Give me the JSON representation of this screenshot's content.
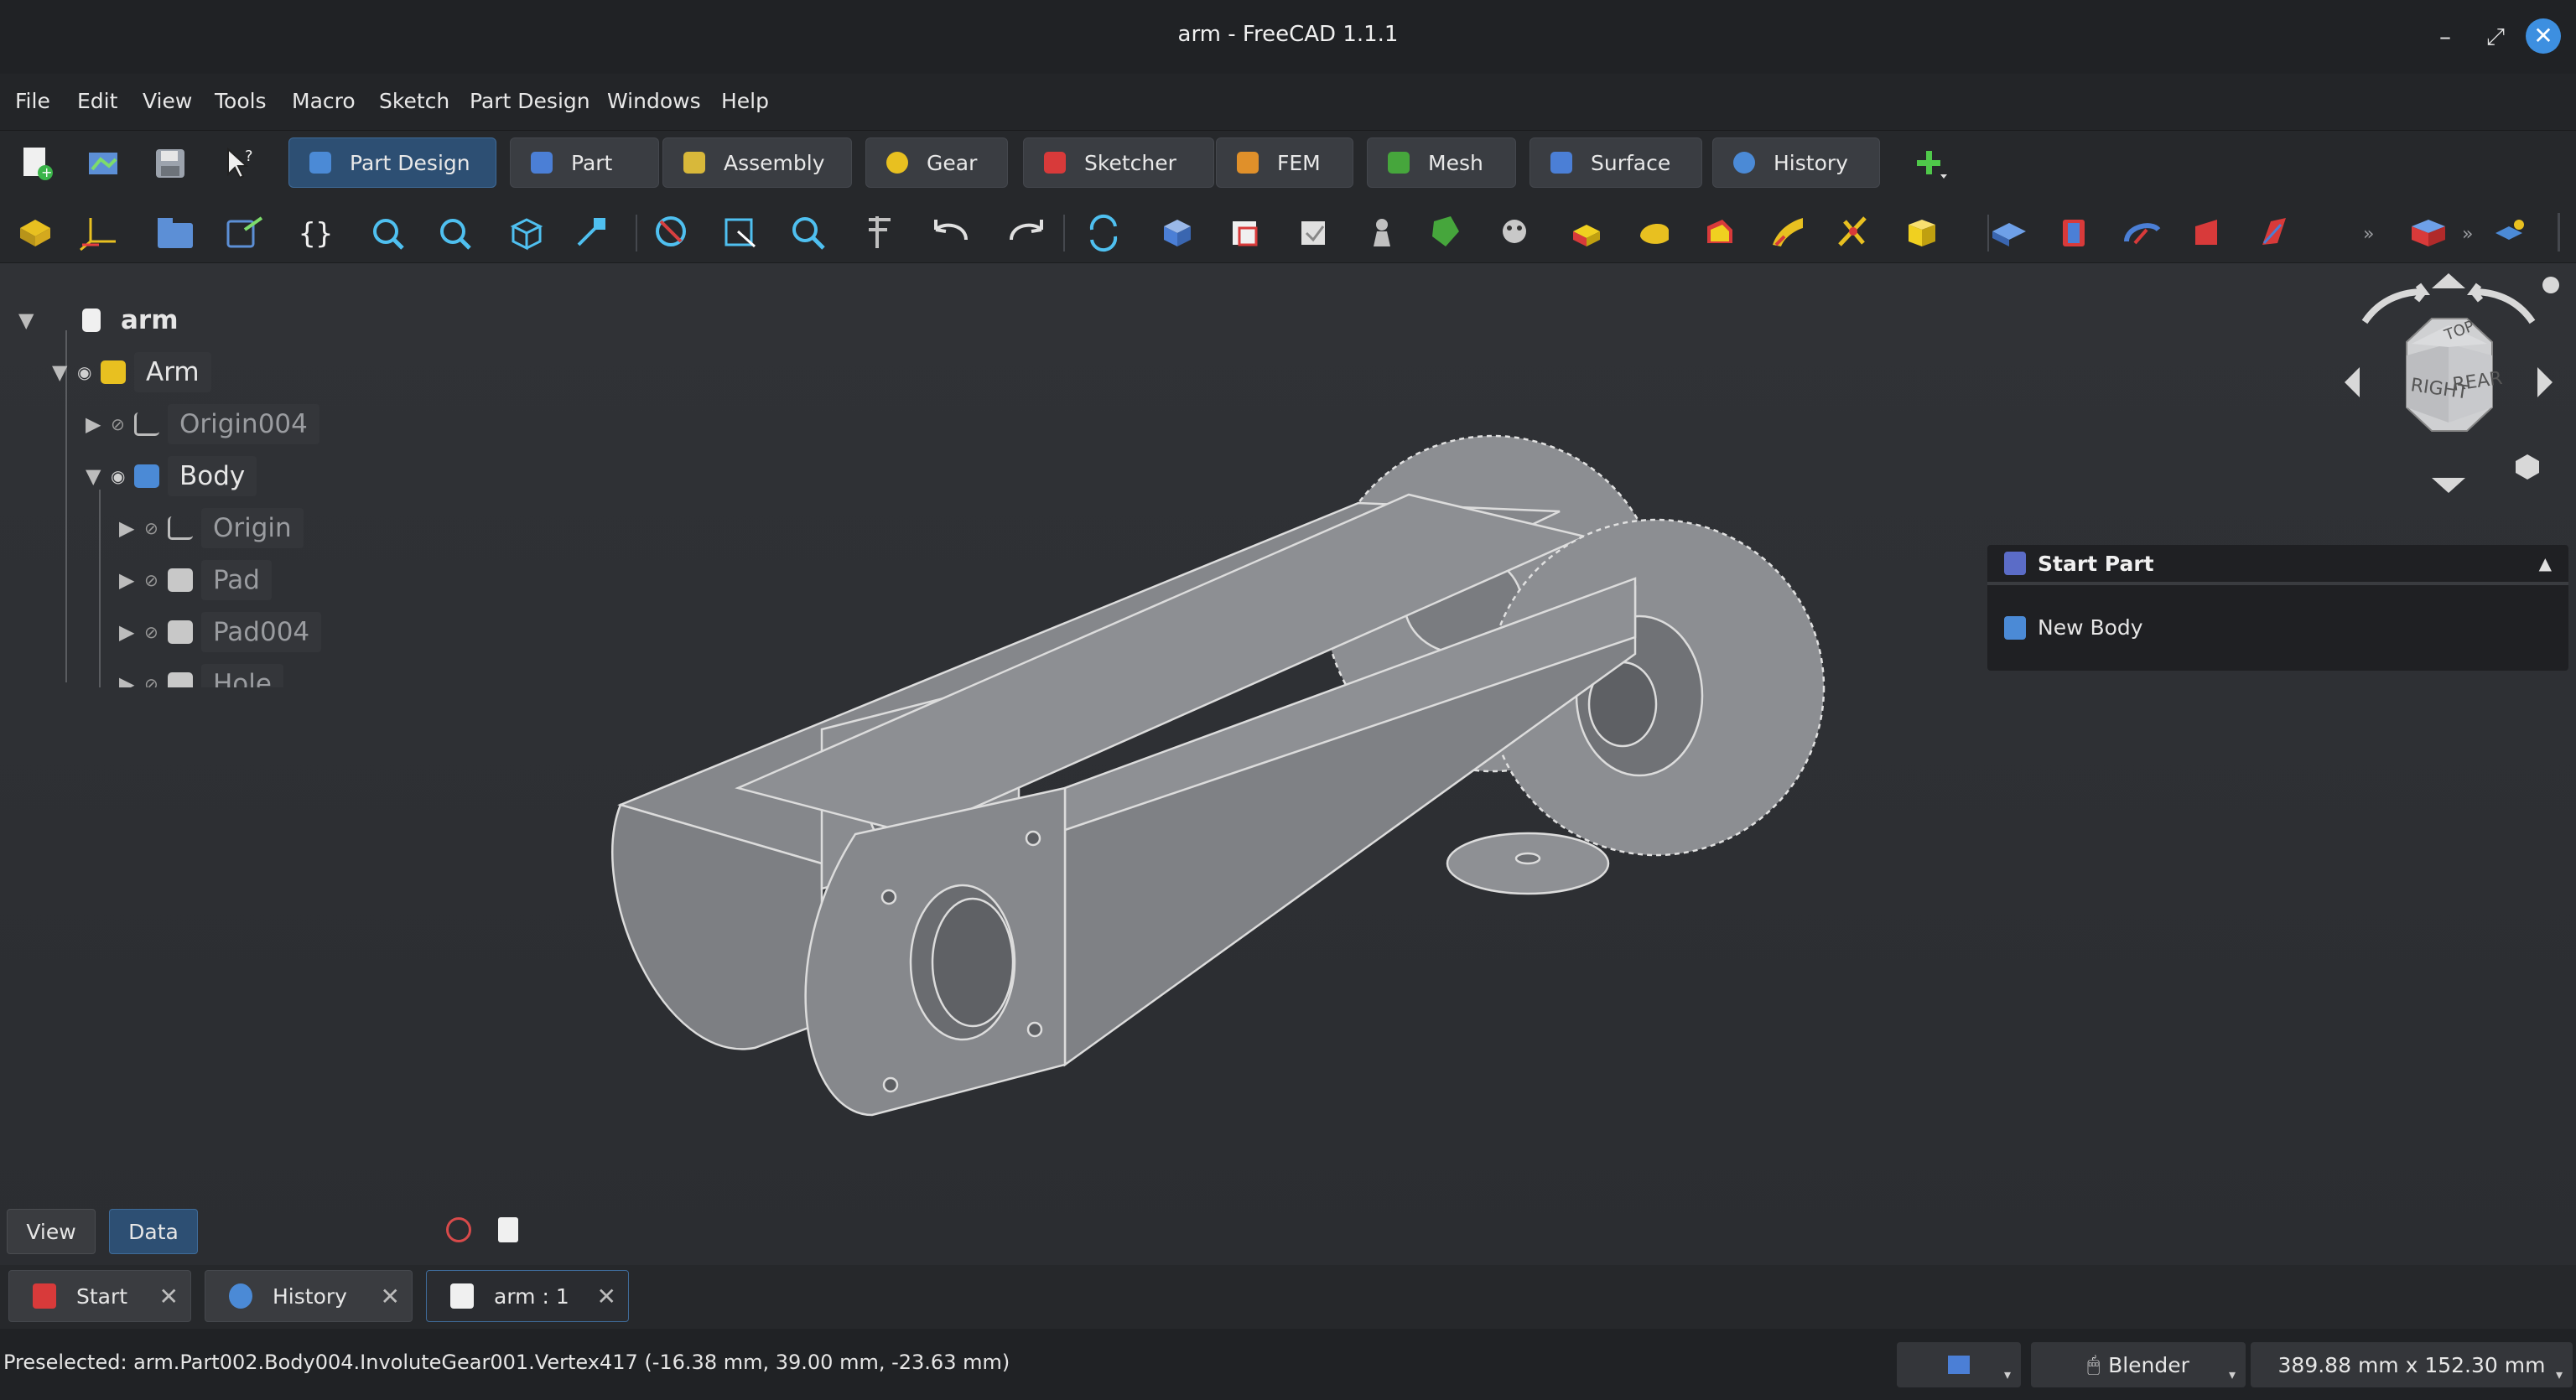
{
  "window": {
    "title": "arm - FreeCAD 1.1.1",
    "minimize": "–",
    "maximize": "⤢",
    "close": "✕"
  },
  "menu": [
    "File",
    "Edit",
    "View",
    "Tools",
    "Macro",
    "Sketch",
    "Part Design",
    "Windows",
    "Help"
  ],
  "workbench_tabs": [
    {
      "label": "Part Design",
      "color": "#4b8ad6",
      "active": true
    },
    {
      "label": "Part",
      "color": "#4b7fd6"
    },
    {
      "label": "Assembly",
      "color": "#d8b83a"
    },
    {
      "label": "Gear",
      "color": "#e8c020"
    },
    {
      "label": "Sketcher",
      "color": "#d83a3a"
    },
    {
      "label": "FEM",
      "color": "#e0902a"
    },
    {
      "label": "Mesh",
      "color": "#46a63c"
    },
    {
      "label": "Surface",
      "color": "#4b7fd6"
    },
    {
      "label": "History",
      "color": "#4b8ad6"
    }
  ],
  "tree": {
    "root": "arm",
    "items": [
      {
        "label": "Arm"
      },
      {
        "label": "Origin004"
      },
      {
        "label": "Body"
      },
      {
        "label": "Origin"
      },
      {
        "label": "Pad"
      },
      {
        "label": "Pad004"
      },
      {
        "label": "Hole"
      }
    ]
  },
  "task_panel": {
    "title": "Start Part",
    "item": "New Body"
  },
  "navcube": {
    "top": "TOP",
    "right": "RIGHT",
    "rear": "REAR"
  },
  "prop_tabs": [
    "View",
    "Data"
  ],
  "mdi_tabs": [
    {
      "label": "Start"
    },
    {
      "label": "History"
    },
    {
      "label": "arm : 1",
      "active": true
    }
  ],
  "status": {
    "text": "Preselected: arm.Part002.Body004.InvoluteGear001.Vertex417 (-16.38 mm, 39.00 mm, -23.63 mm)",
    "nav_style": "Blender",
    "dimensions": "389.88 mm x 152.30 mm"
  },
  "colors": {
    "accent": "#3f6b99",
    "close_button": "#3d8fe0",
    "model_fill": "#8a8c90",
    "model_edge": "#dcdcdc"
  }
}
